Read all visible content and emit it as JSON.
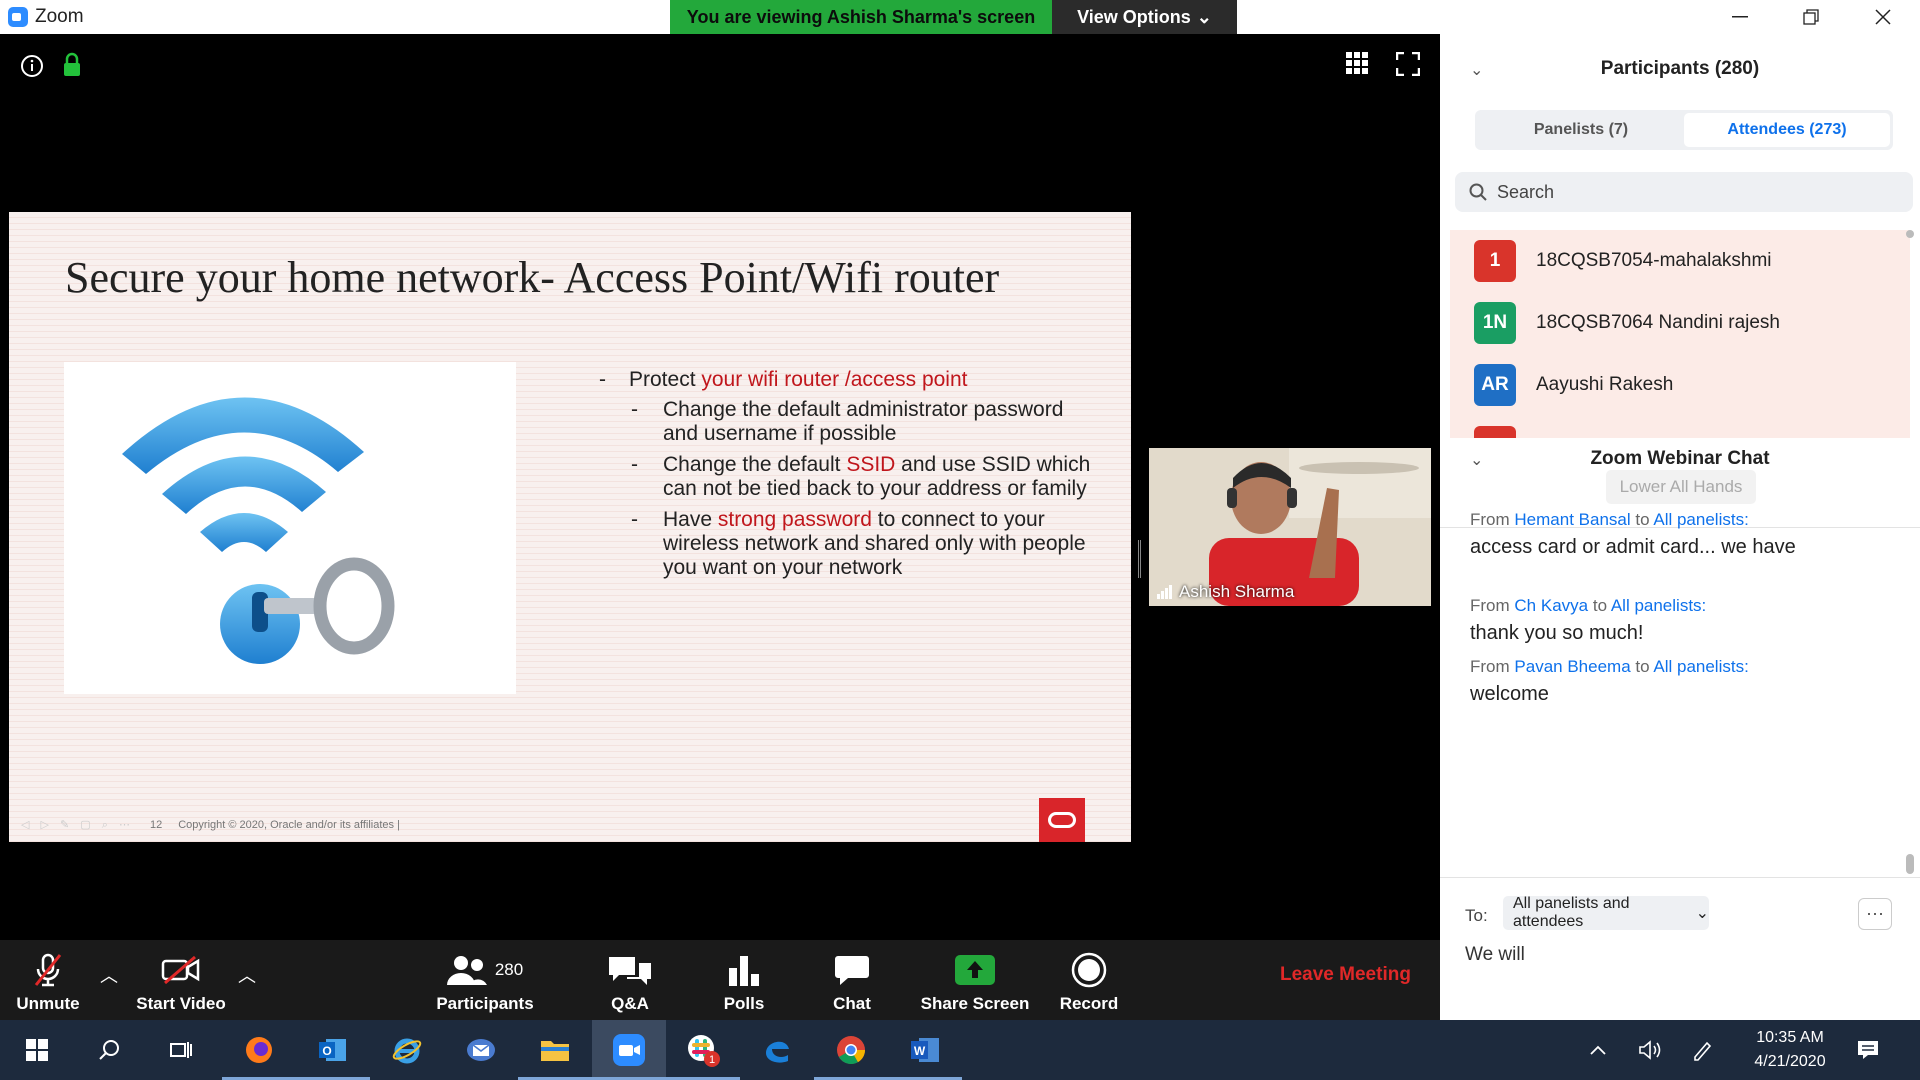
{
  "window": {
    "title": "Zoom"
  },
  "banner": {
    "viewing": "You are viewing Ashish Sharma's screen",
    "view_options": "View Options"
  },
  "slide": {
    "title": "Secure your home network- Access Point/Wifi router",
    "bullet_main_prefix": "Protect ",
    "bullet_main_highlight": "your wifi router /access point",
    "sub1": "Change the default administrator password and username if possible",
    "sub2_a": "Change the default ",
    "sub2_hl": "SSID",
    "sub2_b": " and use SSID which can not be tied back to your address or family",
    "sub3_a": "Have ",
    "sub3_hl": "strong password",
    "sub3_b": " to connect to your wireless network and shared only with people you want on your network",
    "page_number": "12",
    "copyright": "Copyright © 2020, Oracle and/or its affiliates  |"
  },
  "video": {
    "name": "Ashish Sharma"
  },
  "toolbar": {
    "unmute": "Unmute",
    "start_video": "Start Video",
    "participants": "Participants",
    "participants_count": "280",
    "qa": "Q&A",
    "polls": "Polls",
    "chat": "Chat",
    "share_screen": "Share Screen",
    "record": "Record",
    "leave": "Leave Meeting"
  },
  "participants": {
    "header": "Participants (280)",
    "tab_panelists": "Panelists (7)",
    "tab_attendees": "Attendees (273)",
    "search_placeholder": "Search",
    "list": [
      {
        "initials": "1",
        "name": "18CQSB7054-mahalakshmi",
        "color": "#d9342b"
      },
      {
        "initials": "1N",
        "name": "18CQSB7064 Nandini rajesh",
        "color": "#1a9e63"
      },
      {
        "initials": "AR",
        "name": "Aayushi Rakesh",
        "color": "#1f6fc5"
      }
    ],
    "lower_all_hands": "Lower All Hands"
  },
  "chat": {
    "header": "Zoom Webinar Chat",
    "from_word": "From",
    "to_word": "to",
    "messages": [
      {
        "sender": "Hemant Bansal",
        "recipient": "All panelists:",
        "text": "access card or admit card... we have"
      },
      {
        "sender": "Ch Kavya",
        "recipient": "All panelists:",
        "text": "thank you so much!"
      },
      {
        "sender": "Pavan Bheema",
        "recipient": "All panelists:",
        "text": "welcome"
      }
    ],
    "to_label": "To:",
    "to_value": "All panelists and attendees",
    "compose_text": "We will"
  },
  "taskbar": {
    "time": "10:35 AM",
    "date": "4/21/2020",
    "slack_badge": "1"
  },
  "colors": {
    "accent": "#0e71eb",
    "banner_green": "#23a83b",
    "leave_red": "#e02828"
  }
}
